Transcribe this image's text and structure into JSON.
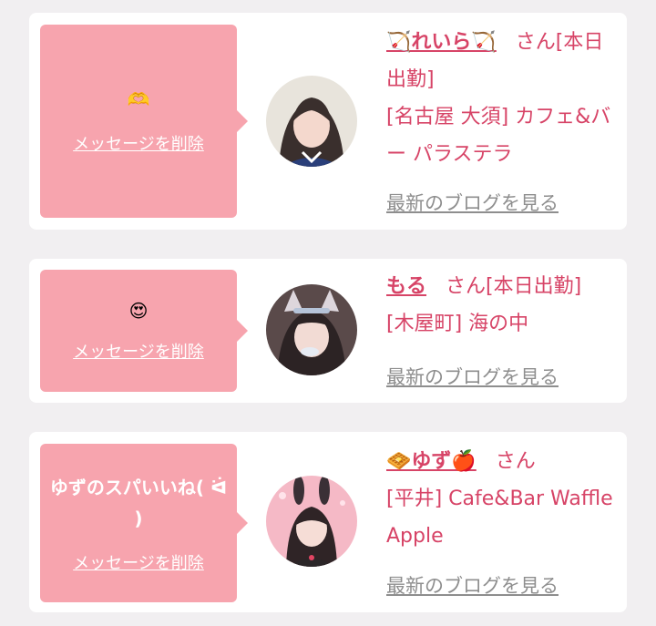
{
  "entries": [
    {
      "bubble_emoji": "🫶",
      "bubble_message": "",
      "delete_label": "メッセージを削除",
      "name": "🏹れいら🏹",
      "honorific": "さん",
      "status": "[本日出勤]",
      "shop": "[名古屋 大須] カフェ&バー パラステラ",
      "blog_label": "最新のブログを見る",
      "avatar_icon": "person-photo-icon"
    },
    {
      "bubble_emoji": "😍",
      "bubble_message": "",
      "delete_label": "メッセージを削除",
      "name": "もる",
      "honorific": "さん",
      "status": "[本日出勤]",
      "shop": "[木屋町] 海の中",
      "blog_label": "最新のブログを見る",
      "avatar_icon": "person-photo-icon"
    },
    {
      "bubble_emoji": "",
      "bubble_message": "ゆずのスパいいね( ᐛ )",
      "delete_label": "メッセージを削除",
      "name": "🧇ゆず🍎",
      "honorific": "さん",
      "status": "",
      "shop": "[平井] Cafe&Bar Waffle Apple",
      "blog_label": "最新のブログを見る",
      "avatar_icon": "person-photo-icon"
    }
  ],
  "colors": {
    "page_bg": "#f1eff1",
    "bubble": "#f7a4ae",
    "accent": "#d74467",
    "link_gray": "#8e8e8e"
  }
}
